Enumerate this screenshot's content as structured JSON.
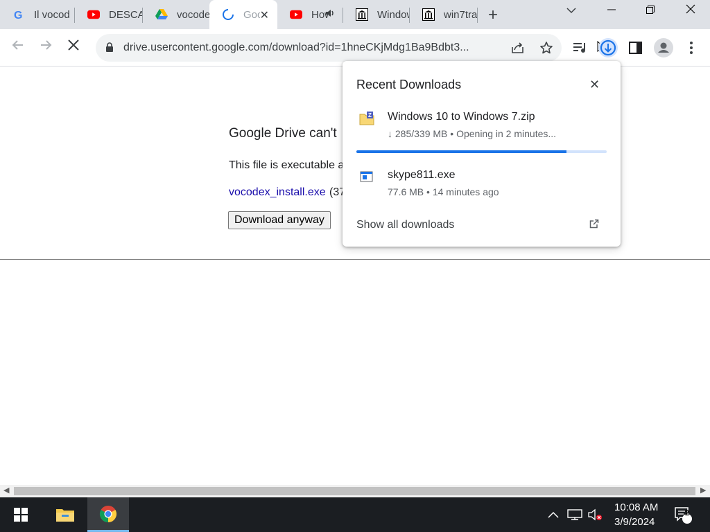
{
  "tabs": [
    {
      "label": "Il vocod",
      "icon": "google-g-icon"
    },
    {
      "label": "DESCAR",
      "icon": "youtube-icon"
    },
    {
      "label": "vocodex",
      "icon": "google-drive-icon"
    },
    {
      "label": "Goo",
      "icon": "loading-spinner-icon",
      "active": true
    },
    {
      "label": "How",
      "icon": "youtube-icon",
      "audio": true
    },
    {
      "label": "Window",
      "icon": "museum-icon"
    },
    {
      "label": "win7tra",
      "icon": "museum-icon"
    }
  ],
  "toolbar": {
    "url": "drive.usercontent.google.com/download?id=1hneCKjMdg1Ba9Bdbt3..."
  },
  "page": {
    "title": "Google Drive can't",
    "description": "This file is executable a",
    "file_link": "vocodex_install.exe",
    "file_size_fragment": "(37",
    "download_button": "Download anyway"
  },
  "downloads_popup": {
    "title": "Recent Downloads",
    "items": [
      {
        "name": "Windows 10 to Windows 7.zip",
        "status": "↓ 285/339 MB • Opening in 2 minutes...",
        "progress": 0.84,
        "icon": "zip-file-icon"
      },
      {
        "name": "skype811.exe",
        "status": "77.6 MB • 14 minutes ago",
        "icon": "exe-file-icon"
      }
    ],
    "show_all": "Show all downloads"
  },
  "taskbar": {
    "time": "10:08 AM",
    "date": "3/9/2024",
    "notifications": "2"
  }
}
